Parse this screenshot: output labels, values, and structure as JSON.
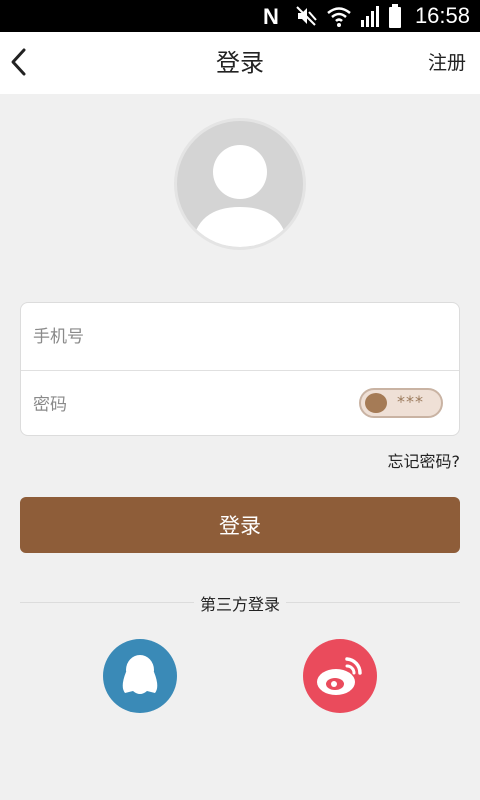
{
  "status_bar": {
    "time": "16:58",
    "icons": [
      "nfc-icon",
      "mute-icon",
      "wifi-icon",
      "signal-icon",
      "battery-icon"
    ]
  },
  "header": {
    "title": "登录",
    "register_label": "注册",
    "back_icon": "chevron-left-icon"
  },
  "avatar": {
    "icon": "avatar-placeholder-icon"
  },
  "form": {
    "phone_placeholder": "手机号",
    "password_placeholder": "密码",
    "password_toggle_text": "***"
  },
  "forgot_password_label": "忘记密码?",
  "login_button_label": "登录",
  "third_party": {
    "label": "第三方登录",
    "providers": [
      {
        "name": "qq",
        "icon": "qq-icon",
        "color": "#3a8ab7"
      },
      {
        "name": "weibo",
        "icon": "weibo-icon",
        "color": "#ea4b5c"
      }
    ]
  },
  "colors": {
    "accent": "#8e5d39",
    "background": "#f0f0f0"
  }
}
